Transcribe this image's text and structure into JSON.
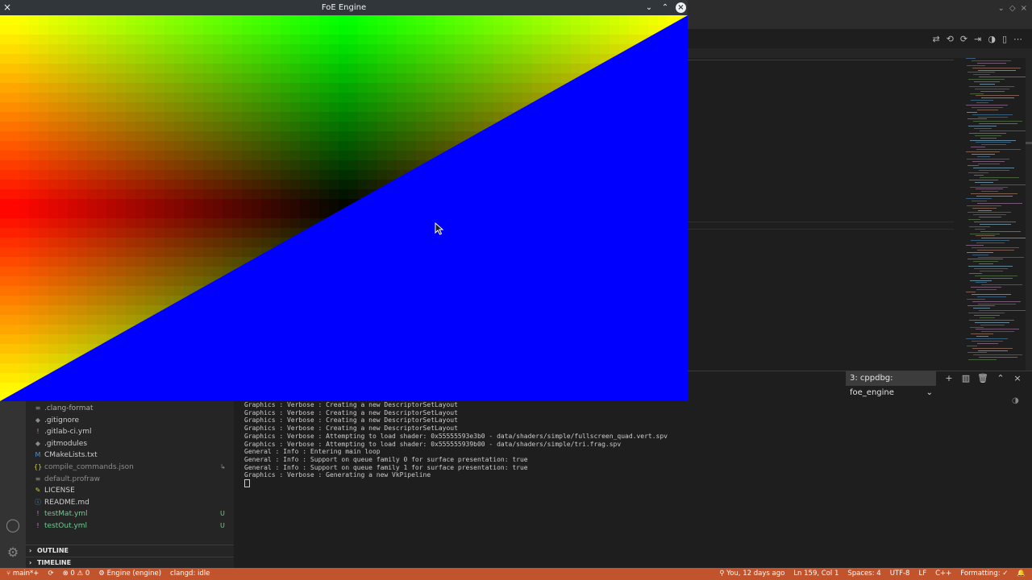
{
  "foe_window": {
    "title": "FoE Engine",
    "menu_icon": "×",
    "minimize_icon": "⌄",
    "maximize_icon": "⌃",
    "close_icon": "×",
    "viewport": {
      "content": "rendered triangle over fullscreen gradient quad",
      "gradient_colors": [
        "#ffff00",
        "#00ff00",
        "#ff0000",
        "#000000"
      ],
      "triangle_color": "#0000ff"
    }
  },
  "vscode": {
    "title_controls": [
      "⌄",
      "◇",
      "×"
    ],
    "toolbar_icons": [
      "⇄",
      "⟲",
      "⟳",
      "⇥",
      "◑",
      "▯",
      "⋯"
    ],
    "explorer": {
      "files": [
        {
          "icon": "≡",
          "name": ".clang-format",
          "color": "#a9a9a9",
          "status": ""
        },
        {
          "icon": "◆",
          "name": ".gitignore",
          "color": "#cccccc",
          "status": ""
        },
        {
          "icon": "!",
          "name": ".gitlab-ci.yml",
          "color": "#cccccc",
          "status": ""
        },
        {
          "icon": "◆",
          "name": ".gitmodules",
          "color": "#cccccc",
          "status": ""
        },
        {
          "icon": "M",
          "name": "CMakeLists.txt",
          "color": "#cccccc",
          "status": ""
        },
        {
          "icon": "{}",
          "name": "compile_commands.json",
          "color": "#8c8c8c",
          "status": "↳"
        },
        {
          "icon": "≡",
          "name": "default.profraw",
          "color": "#8c8c8c",
          "status": ""
        },
        {
          "icon": "✎",
          "name": "LICENSE",
          "color": "#cccccc",
          "status": ""
        },
        {
          "icon": "ⓘ",
          "name": "README.md",
          "color": "#cccccc",
          "status": ""
        },
        {
          "icon": "!",
          "name": "testMat.yml",
          "color": "#73c991",
          "status": "U"
        },
        {
          "icon": "!",
          "name": "testOut.yml",
          "color": "#73c991",
          "status": "U"
        }
      ],
      "sections": [
        "OUTLINE",
        "TIMELINE"
      ]
    },
    "panel": {
      "selected_terminal": "3: cppdbg: foe_engine",
      "terminal_lines": [
        "Graphics : Verbose : Creating a new DescriptorSetLayout",
        "Graphics : Verbose : Creating a new DescriptorSetLayout",
        "Graphics : Verbose : Creating a new DescriptorSetLayout",
        "Graphics : Verbose : Creating a new DescriptorSetLayout",
        "Graphics : Verbose : Attempting to load shader: 0x55555593e3b0 - data/shaders/simple/fullscreen_quad.vert.spv",
        "Graphics : Verbose : Attempting to load shader: 0x555555939b00 - data/shaders/simple/tri.frag.spv",
        "General : Info : Entering main loop",
        "General : Info : Support on queue family 0 for surface presentation: true",
        "General : Info : Support on queue family 1 for surface presentation: true",
        "Graphics : Verbose : Generating a new VkPipeline"
      ]
    },
    "statusbar": {
      "branch": "main*+",
      "sync_icon": "⟳",
      "problems": "⊗ 0 ⚠ 0",
      "debug": "Engine (engine)",
      "clangd": "clangd: idle",
      "blame": "You, 12 days ago",
      "position": "Ln 159, Col 1",
      "spaces": "Spaces: 4",
      "encoding": "UTF-8",
      "eol": "LF",
      "language": "C++",
      "formatting": "Formatting: ✓",
      "bell_icon": "🔔"
    }
  }
}
